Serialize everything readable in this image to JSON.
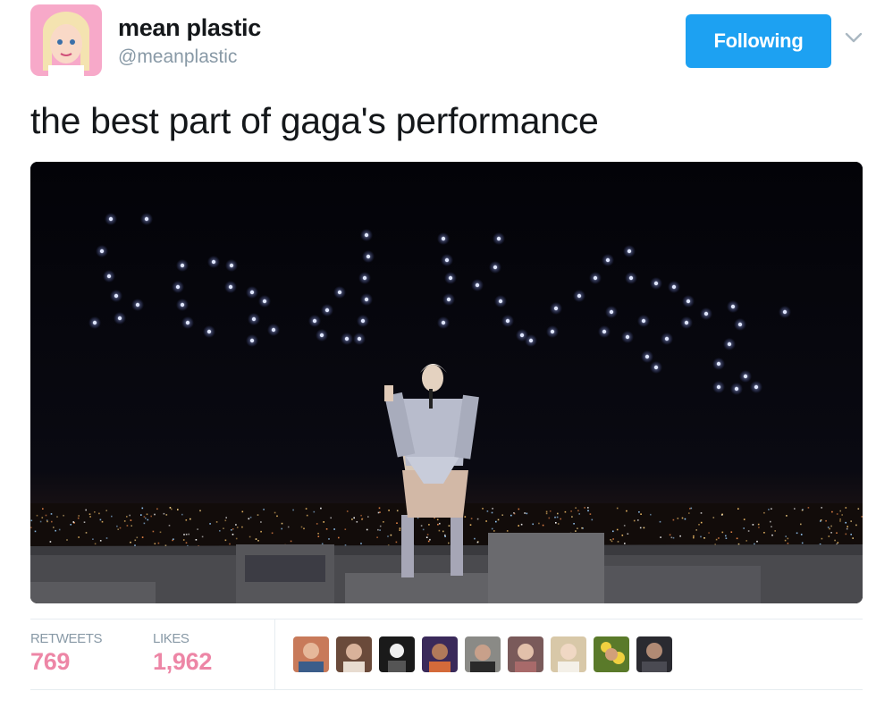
{
  "author": {
    "display_name": "mean plastic",
    "handle": "@meanplastic"
  },
  "follow_button": {
    "label": "Following"
  },
  "tweet": {
    "text": "the best part of gaga's performance"
  },
  "stats": {
    "retweets_label": "RETWEETS",
    "retweets_count": "769",
    "likes_label": "LIKES",
    "likes_count": "1,962"
  },
  "colors": {
    "accent": "#1da1f2",
    "likes": "#e0245e",
    "muted": "#8899a6"
  },
  "liker_avatars": [
    {
      "name": "liker-1"
    },
    {
      "name": "liker-2"
    },
    {
      "name": "liker-3"
    },
    {
      "name": "liker-4"
    },
    {
      "name": "liker-5"
    },
    {
      "name": "liker-6"
    },
    {
      "name": "liker-7"
    },
    {
      "name": "liker-8"
    },
    {
      "name": "liker-9"
    }
  ]
}
